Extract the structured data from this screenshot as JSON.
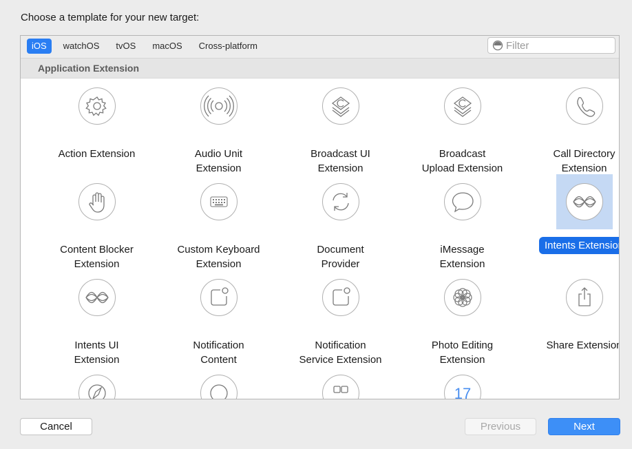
{
  "heading": "Choose a template for your new target:",
  "platform_tabs": [
    {
      "label": "iOS",
      "active": true
    },
    {
      "label": "watchOS",
      "active": false
    },
    {
      "label": "tvOS",
      "active": false
    },
    {
      "label": "macOS",
      "active": false
    },
    {
      "label": "Cross-platform",
      "active": false
    }
  ],
  "filter": {
    "placeholder": "Filter",
    "icon": "filter-icon"
  },
  "section_title": "Application Extension",
  "templates": [
    {
      "line1": "Action Extension",
      "line2": "",
      "icon": "gear-icon"
    },
    {
      "line1": "Audio Unit",
      "line2": "Extension",
      "icon": "audio-waves-icon"
    },
    {
      "line1": "Broadcast UI",
      "line2": "Extension",
      "icon": "broadcast-stack-icon"
    },
    {
      "line1": "Broadcast",
      "line2": "Upload Extension",
      "icon": "broadcast-stack-icon"
    },
    {
      "line1": "Call Directory",
      "line2": "Extension",
      "icon": "phone-icon"
    },
    {
      "line1": "Content Blocker",
      "line2": "Extension",
      "icon": "hand-icon"
    },
    {
      "line1": "Custom Keyboard",
      "line2": "Extension",
      "icon": "keyboard-icon"
    },
    {
      "line1": "Document",
      "line2": "Provider",
      "icon": "refresh-arrows-icon"
    },
    {
      "line1": "iMessage",
      "line2": "Extension",
      "icon": "speech-bubble-icon"
    },
    {
      "line1": "Intents Extension",
      "line2": "",
      "icon": "siri-waves-icon",
      "selected": true
    },
    {
      "line1": "Intents UI",
      "line2": "Extension",
      "icon": "siri-waves-icon"
    },
    {
      "line1": "Notification",
      "line2": "Content",
      "icon": "notification-icon"
    },
    {
      "line1": "Notification",
      "line2": "Service Extension",
      "icon": "notification-icon"
    },
    {
      "line1": "Photo Editing",
      "line2": "Extension",
      "icon": "flower-icon"
    },
    {
      "line1": "Share Extension",
      "line2": "",
      "icon": "share-icon"
    },
    {
      "line1": "",
      "line2": "",
      "icon": "safari-icon"
    },
    {
      "line1": "",
      "line2": "",
      "icon": "circle-icon"
    },
    {
      "line1": "",
      "line2": "",
      "icon": "grid-squares-icon"
    },
    {
      "line1": "",
      "line2": "",
      "icon": "calendar-icon",
      "icon_text": "17"
    }
  ],
  "buttons": {
    "cancel": "Cancel",
    "previous": "Previous",
    "next": "Next"
  },
  "colors": {
    "accent": "#2a7ef3",
    "selection_bg": "#c5d9f4",
    "selection_label": "#1a6ee8",
    "icon_stroke": "#7a7a7a"
  }
}
